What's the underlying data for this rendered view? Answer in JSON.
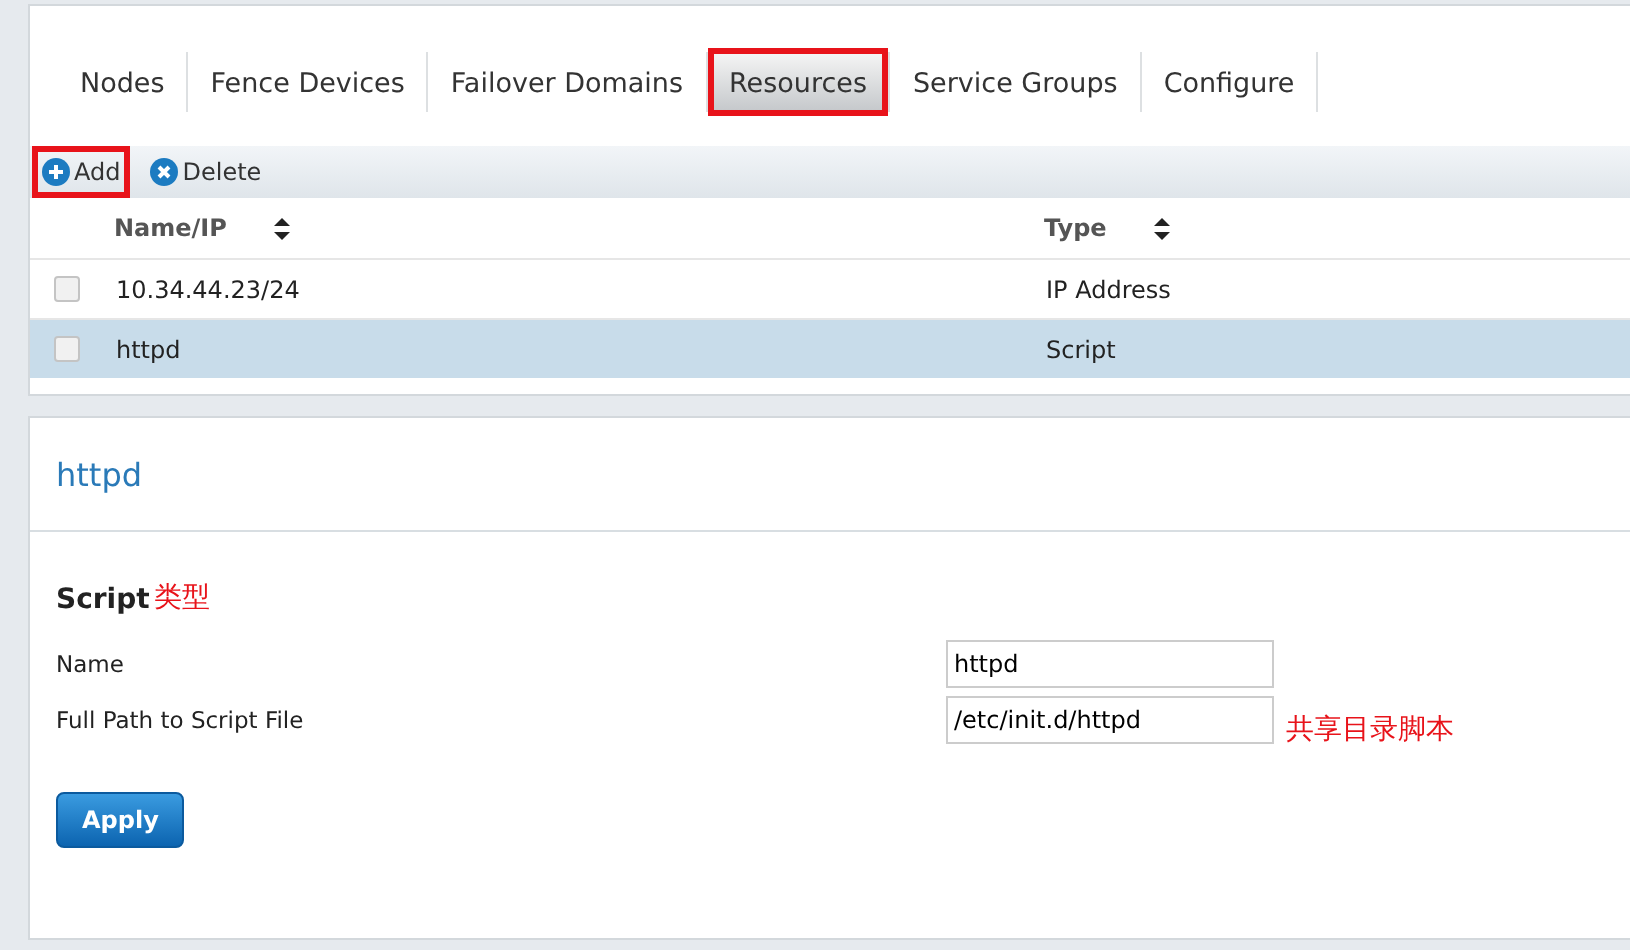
{
  "tabs": [
    {
      "label": "Nodes",
      "selected": false,
      "outlined": false
    },
    {
      "label": "Fence Devices",
      "selected": false,
      "outlined": false
    },
    {
      "label": "Failover Domains",
      "selected": false,
      "outlined": false
    },
    {
      "label": "Resources",
      "selected": true,
      "outlined": true
    },
    {
      "label": "Service Groups",
      "selected": false,
      "outlined": false
    },
    {
      "label": "Configure",
      "selected": false,
      "outlined": false
    }
  ],
  "toolbar": [
    {
      "label": "Add",
      "kind": "add",
      "outlined": true
    },
    {
      "label": "Delete",
      "kind": "delete",
      "outlined": false
    }
  ],
  "table": {
    "columns": [
      "Name/IP",
      "Type"
    ],
    "rows": [
      {
        "cells": [
          "10.34.44.23/24",
          "IP Address"
        ],
        "checked": false,
        "selected": false
      },
      {
        "cells": [
          "httpd",
          "Script"
        ],
        "checked": false,
        "selected": true
      }
    ]
  },
  "detail": {
    "title": "httpd",
    "section": "Script",
    "section_note": "类型",
    "fields": [
      {
        "label": "Name",
        "value": "httpd"
      },
      {
        "label": "Full Path to Script File",
        "value": "/etc/init.d/httpd",
        "note": "共享目录脚本"
      }
    ],
    "apply": "Apply"
  }
}
